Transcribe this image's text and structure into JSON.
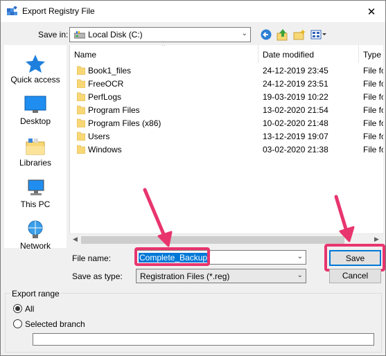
{
  "window": {
    "title": "Export Registry File",
    "close_glyph": "✕"
  },
  "toolbar": {
    "save_in_label": "Save in:",
    "location": "Local Disk (C:)",
    "icons": [
      "back-icon",
      "up-folder-icon",
      "new-folder-icon",
      "view-menu-icon"
    ]
  },
  "sidebar": {
    "items": [
      {
        "label": "Quick access",
        "icon": "quick-access-icon"
      },
      {
        "label": "Desktop",
        "icon": "desktop-icon"
      },
      {
        "label": "Libraries",
        "icon": "libraries-icon"
      },
      {
        "label": "This PC",
        "icon": "this-pc-icon"
      },
      {
        "label": "Network",
        "icon": "network-icon"
      }
    ]
  },
  "files": {
    "columns": [
      "Name",
      "Date modified",
      "Type"
    ],
    "rows": [
      {
        "name": "Book1_files",
        "date": "24-12-2019 23:45",
        "type": "File fo"
      },
      {
        "name": "FreeOCR",
        "date": "24-12-2019 23:51",
        "type": "File fo"
      },
      {
        "name": "PerfLogs",
        "date": "19-03-2019 10:22",
        "type": "File fo"
      },
      {
        "name": "Program Files",
        "date": "13-02-2020 21:54",
        "type": "File fo"
      },
      {
        "name": "Program Files (x86)",
        "date": "10-02-2020 21:48",
        "type": "File fo"
      },
      {
        "name": "Users",
        "date": "13-12-2019 19:07",
        "type": "File fo"
      },
      {
        "name": "Windows",
        "date": "03-02-2020 21:38",
        "type": "File fo"
      }
    ]
  },
  "form": {
    "file_name_label": "File name:",
    "file_name_value": "Complete_Backup",
    "save_as_label": "Save as type:",
    "save_as_value": "Registration Files (*.reg)",
    "save_label": "Save",
    "cancel_label": "Cancel"
  },
  "export_range": {
    "group_label": "Export range",
    "all_label": "All",
    "selected_branch_label": "Selected branch",
    "selected": "All",
    "branch_value": ""
  },
  "colors": {
    "accent": "#0078d7",
    "annotation": "#e8356e",
    "folder": "#f8d775"
  }
}
